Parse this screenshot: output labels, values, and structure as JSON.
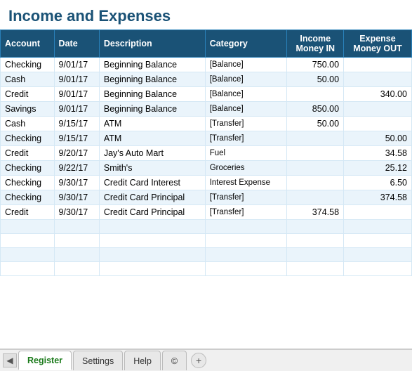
{
  "page": {
    "title": "Income and Expenses"
  },
  "table": {
    "headers": [
      {
        "label": "Account",
        "align": "left"
      },
      {
        "label": "Date",
        "align": "left"
      },
      {
        "label": "Description",
        "align": "left"
      },
      {
        "label": "Category",
        "align": "left"
      },
      {
        "label": "Income\nMoney IN",
        "align": "center"
      },
      {
        "label": "Expense\nMoney OUT",
        "align": "center"
      }
    ],
    "rows": [
      {
        "account": "Checking",
        "date": "9/01/17",
        "description": "Beginning Balance",
        "category": "[Balance]",
        "income": "750.00",
        "expense": ""
      },
      {
        "account": "Cash",
        "date": "9/01/17",
        "description": "Beginning Balance",
        "category": "[Balance]",
        "income": "50.00",
        "expense": ""
      },
      {
        "account": "Credit",
        "date": "9/01/17",
        "description": "Beginning Balance",
        "category": "[Balance]",
        "income": "",
        "expense": "340.00"
      },
      {
        "account": "Savings",
        "date": "9/01/17",
        "description": "Beginning Balance",
        "category": "[Balance]",
        "income": "850.00",
        "expense": ""
      },
      {
        "account": "Cash",
        "date": "9/15/17",
        "description": "ATM",
        "category": "[Transfer]",
        "income": "50.00",
        "expense": ""
      },
      {
        "account": "Checking",
        "date": "9/15/17",
        "description": "ATM",
        "category": "[Transfer]",
        "income": "",
        "expense": "50.00"
      },
      {
        "account": "Credit",
        "date": "9/20/17",
        "description": "Jay's Auto Mart",
        "category": "Fuel",
        "income": "",
        "expense": "34.58"
      },
      {
        "account": "Checking",
        "date": "9/22/17",
        "description": "Smith's",
        "category": "Groceries",
        "income": "",
        "expense": "25.12"
      },
      {
        "account": "Checking",
        "date": "9/30/17",
        "description": "Credit Card Interest",
        "category": "Interest Expense",
        "income": "",
        "expense": "6.50"
      },
      {
        "account": "Checking",
        "date": "9/30/17",
        "description": "Credit Card Principal",
        "category": "[Transfer]",
        "income": "",
        "expense": "374.58"
      },
      {
        "account": "Credit",
        "date": "9/30/17",
        "description": "Credit Card Principal",
        "category": "[Transfer]",
        "income": "374.58",
        "expense": ""
      },
      {
        "account": "",
        "date": "",
        "description": "",
        "category": "",
        "income": "",
        "expense": ""
      },
      {
        "account": "",
        "date": "",
        "description": "",
        "category": "",
        "income": "",
        "expense": ""
      },
      {
        "account": "",
        "date": "",
        "description": "",
        "category": "",
        "income": "",
        "expense": ""
      },
      {
        "account": "",
        "date": "",
        "description": "",
        "category": "",
        "income": "",
        "expense": ""
      }
    ]
  },
  "tabs": [
    {
      "label": "Register",
      "active": true
    },
    {
      "label": "Settings",
      "active": false
    },
    {
      "label": "Help",
      "active": false
    },
    {
      "label": "©",
      "active": false
    }
  ],
  "tab_add_label": "+"
}
